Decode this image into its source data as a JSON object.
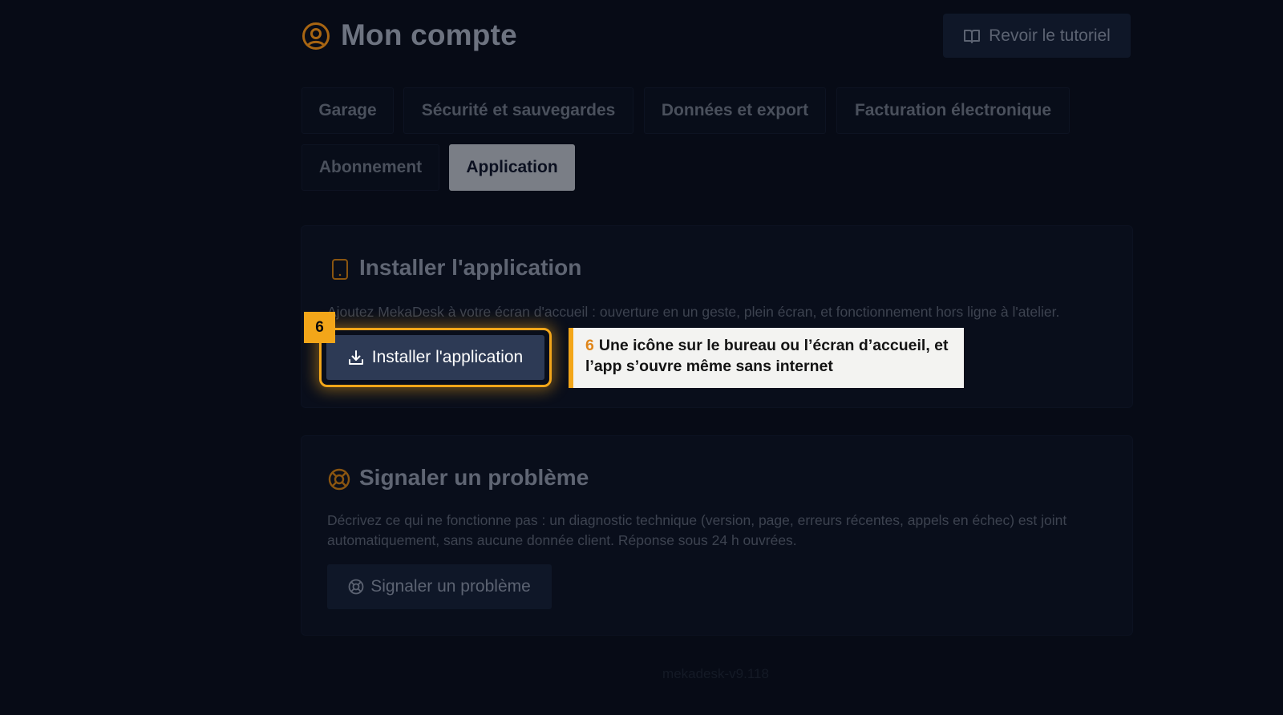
{
  "header": {
    "title": "Mon compte",
    "title_icon": "user-circle-icon",
    "tutorial_label": "Revoir le tutoriel",
    "tutorial_icon": "book-open-icon"
  },
  "tabs": [
    {
      "label": "Garage",
      "active": false
    },
    {
      "label": "Sécurité et sauvegardes",
      "active": false
    },
    {
      "label": "Données et export",
      "active": false
    },
    {
      "label": "Facturation électronique",
      "active": false
    },
    {
      "label": "Abonnement",
      "active": false
    },
    {
      "label": "Application",
      "active": true
    }
  ],
  "install_card": {
    "icon": "smartphone-icon",
    "title": "Installer l'application",
    "description": "Ajoutez MekaDesk à votre écran d'accueil : ouverture en un geste, plein écran, et fonctionnement hors ligne à l'atelier.",
    "button_label": "Installer l'application",
    "button_icon": "download-icon"
  },
  "tutorial_step": {
    "badge": "6",
    "number": "6",
    "text": "Une icône sur le bureau ou l’écran d’accueil, et l’app s’ouvre même sans internet"
  },
  "report_card": {
    "icon": "lifebuoy-icon",
    "title": "Signaler un problème",
    "description": "Décrivez ce qui ne fonctionne pas : un diagnostic technique (version, page, erreurs récentes, appels en échec) est joint automatiquement, sans aucune donnée client. Réponse sous 24 h ouvrées.",
    "button_label": "Signaler un problème",
    "button_icon": "lifebuoy-icon"
  },
  "footer": {
    "version": "mekadesk-v9.118"
  },
  "colors": {
    "background": "#070b16",
    "accent": "#f3a619",
    "active_tab": "#7a7e86",
    "primary_button": "#2d3a55"
  }
}
